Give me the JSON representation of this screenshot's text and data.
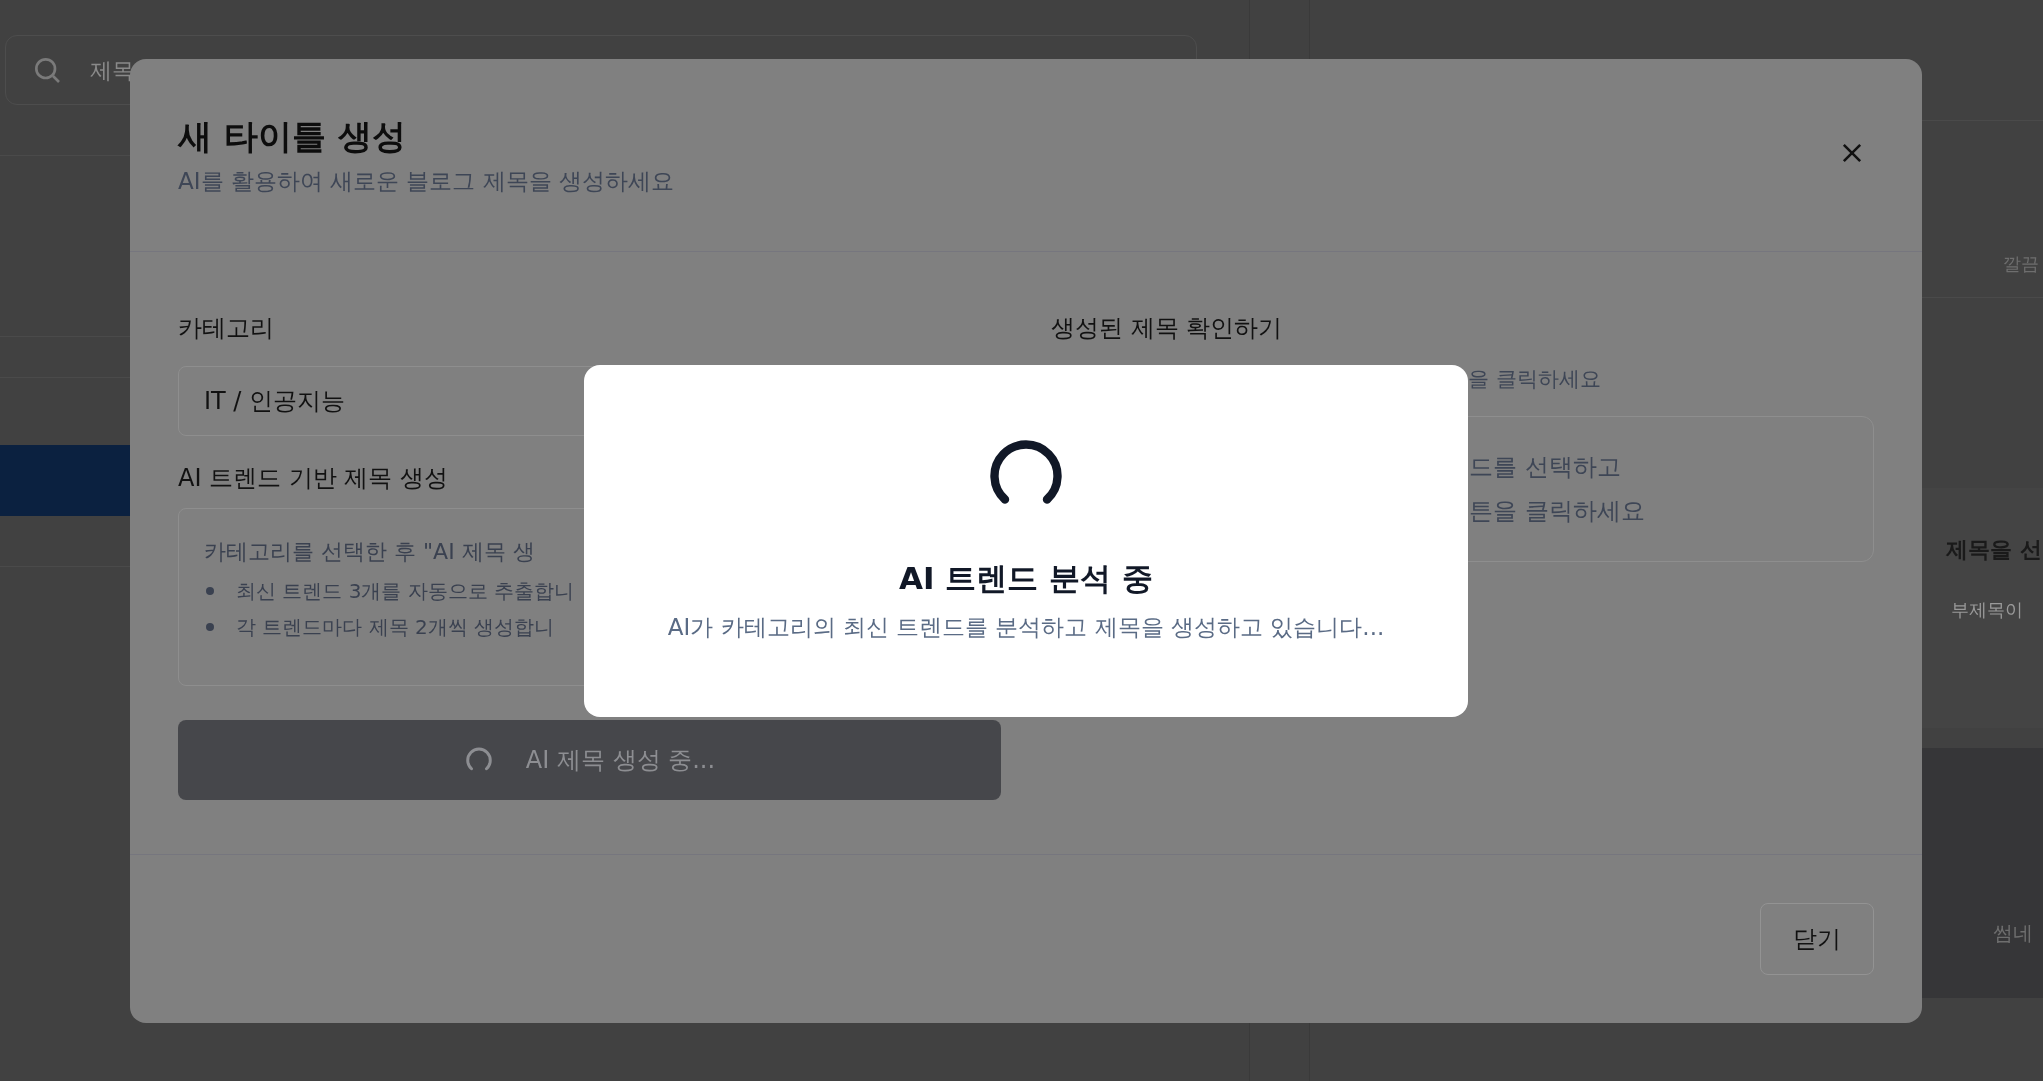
{
  "background": {
    "search": {
      "placeholder": "제목"
    },
    "right_panel": {
      "card_text": "깔끔",
      "heading": "제목을 선",
      "subheading": "부제목이",
      "thumbnail_caption": "썸네"
    }
  },
  "dialog": {
    "title": "새 타이틀 생성",
    "subtitle": "AI를 활용하여 새로운 블로그 제목을 생성하세요",
    "category": {
      "label": "카테고리",
      "value": "IT / 인공지능"
    },
    "trend": {
      "label": "AI 트렌드 기반 제목 생성",
      "intro": "카테고리를 선택한 후 \"AI 제목 생",
      "bullets": [
        "최신 트렌드 3개를 자동으로 추출합니",
        "각 트렌드마다 제목 2개씩 생성합니"
      ]
    },
    "generate_button": {
      "label": "AI 제목 생성 중...",
      "disabled": true
    },
    "results": {
      "label": "생성된 제목 확인하기",
      "hint": "을 클릭하세요",
      "empty_lines": [
        "드를 선택하고",
        "튼을 클릭하세요"
      ]
    },
    "close_button": "닫기"
  },
  "loading": {
    "title": "AI 트렌드 분석 중",
    "message": "AI가 카테고리의 최신 트렌드를 분석하고 제목을 생성하고 있습니다..."
  }
}
